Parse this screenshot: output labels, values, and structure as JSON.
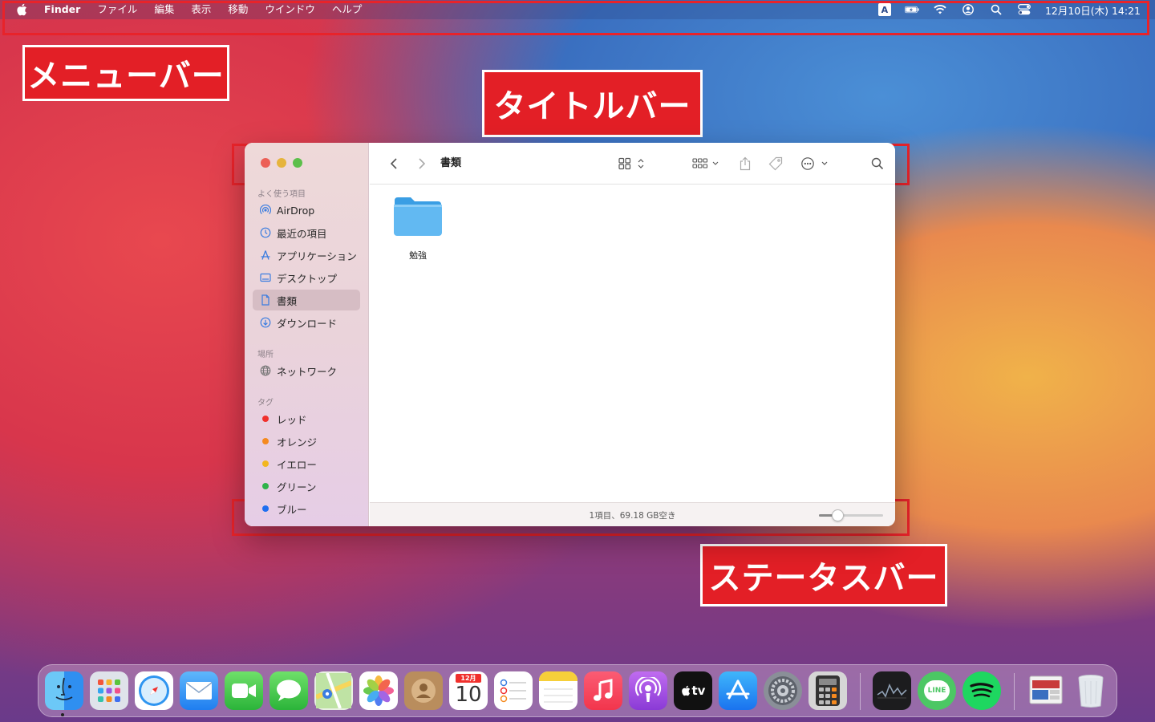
{
  "menubar": {
    "app_name": "Finder",
    "menus": [
      "ファイル",
      "編集",
      "表示",
      "移動",
      "ウインドウ",
      "ヘルプ"
    ],
    "input_indicator": "A",
    "clock": "12月10日(木) 14:21",
    "status_icons": [
      "input-source-icon",
      "battery-charging-icon",
      "wifi-icon",
      "user-icon",
      "search-icon",
      "control-center-icon"
    ]
  },
  "annotations": {
    "menubar_label": "メニューバー",
    "titlebar_label": "タイトルバー",
    "statusbar_label": "ステータスバー",
    "color": "#e31f26"
  },
  "finder": {
    "title": "書類",
    "sidebar": {
      "favorites_header": "よく使う項目",
      "favorites": [
        {
          "label": "AirDrop",
          "icon": "airdrop-icon"
        },
        {
          "label": "最近の項目",
          "icon": "clock-icon"
        },
        {
          "label": "アプリケーション",
          "icon": "applications-icon"
        },
        {
          "label": "デスクトップ",
          "icon": "desktop-icon"
        },
        {
          "label": "書類",
          "icon": "document-icon",
          "selected": true
        },
        {
          "label": "ダウンロード",
          "icon": "download-icon"
        }
      ],
      "locations_header": "場所",
      "locations": [
        {
          "label": "ネットワーク",
          "icon": "network-icon"
        }
      ],
      "tags_header": "タグ",
      "tags": [
        {
          "label": "レッド",
          "color": "#f0302c"
        },
        {
          "label": "オレンジ",
          "color": "#f58a1f"
        },
        {
          "label": "イエロー",
          "color": "#f2b61f"
        },
        {
          "label": "グリーン",
          "color": "#2fb34a"
        },
        {
          "label": "ブルー",
          "color": "#1f6ff0"
        }
      ]
    },
    "items": [
      {
        "label": "勉強",
        "icon": "folder-icon"
      }
    ],
    "status": {
      "text": "1項目、69.18 GB空き",
      "icon_size_level": 0.25
    }
  },
  "dock": {
    "apps": [
      "Finder",
      "Launchpad",
      "Safari",
      "Mail",
      "FaceTime",
      "Messages",
      "Maps",
      "Photos",
      "Contacts",
      "Calendar",
      "Reminders",
      "Notes",
      "Music",
      "Podcasts",
      "TV",
      "App Store",
      "System Preferences",
      "Calculator",
      "Stocks",
      "LINE",
      "Spotify",
      "Preview",
      "Trash"
    ],
    "calendar_month": "12月",
    "calendar_day": "10",
    "tv_label": "tv",
    "line_label": "LINE"
  }
}
